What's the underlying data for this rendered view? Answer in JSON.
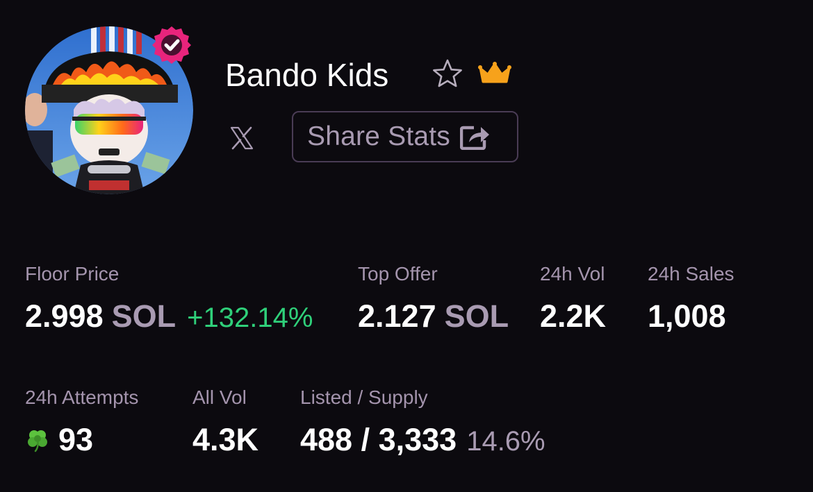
{
  "header": {
    "collection_name": "Bando Kids",
    "share_label": "Share Stats"
  },
  "colors": {
    "background": "#0c0a0f",
    "muted_text": "#a494ad",
    "positive_change": "#2fd07a",
    "verified_badge": "#e8247c",
    "crown": "#f7a21b"
  },
  "icons": {
    "verified": "verified-check-badge",
    "favorite": "star-outline",
    "rank": "crown",
    "social": "x-logo",
    "share": "share-external",
    "attempts": "four-leaf-clover"
  },
  "stats": {
    "floor_price": {
      "label": "Floor Price",
      "value": "2.998",
      "unit": "SOL",
      "change": "+132.14%"
    },
    "top_offer": {
      "label": "Top Offer",
      "value": "2.127",
      "unit": "SOL"
    },
    "vol_24h": {
      "label": "24h Vol",
      "value": "2.2K"
    },
    "sales_24h": {
      "label": "24h Sales",
      "value": "1,008"
    },
    "attempts_24h": {
      "label": "24h Attempts",
      "value": "93"
    },
    "all_vol": {
      "label": "All Vol",
      "value": "4.3K"
    },
    "listed_supply": {
      "label": "Listed / Supply",
      "value": "488 / 3,333",
      "percent": "14.6%"
    }
  }
}
